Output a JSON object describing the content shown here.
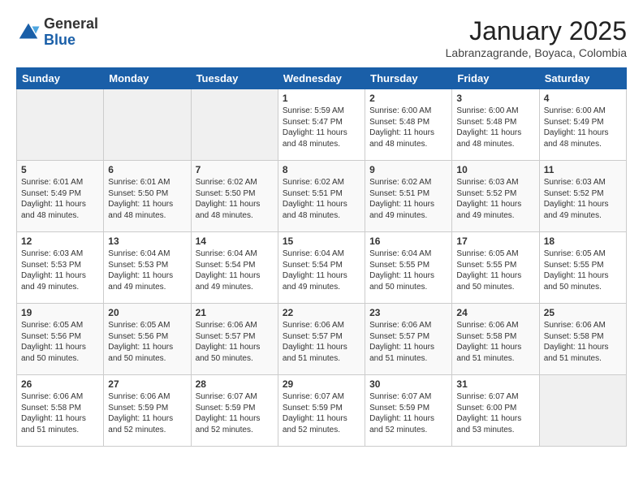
{
  "header": {
    "logo_general": "General",
    "logo_blue": "Blue",
    "month_title": "January 2025",
    "subtitle": "Labranzagrande, Boyaca, Colombia"
  },
  "days_of_week": [
    "Sunday",
    "Monday",
    "Tuesday",
    "Wednesday",
    "Thursday",
    "Friday",
    "Saturday"
  ],
  "weeks": [
    [
      {
        "day": "",
        "content": ""
      },
      {
        "day": "",
        "content": ""
      },
      {
        "day": "",
        "content": ""
      },
      {
        "day": "1",
        "content": "Sunrise: 5:59 AM\nSunset: 5:47 PM\nDaylight: 11 hours and 48 minutes."
      },
      {
        "day": "2",
        "content": "Sunrise: 6:00 AM\nSunset: 5:48 PM\nDaylight: 11 hours and 48 minutes."
      },
      {
        "day": "3",
        "content": "Sunrise: 6:00 AM\nSunset: 5:48 PM\nDaylight: 11 hours and 48 minutes."
      },
      {
        "day": "4",
        "content": "Sunrise: 6:00 AM\nSunset: 5:49 PM\nDaylight: 11 hours and 48 minutes."
      }
    ],
    [
      {
        "day": "5",
        "content": "Sunrise: 6:01 AM\nSunset: 5:49 PM\nDaylight: 11 hours and 48 minutes."
      },
      {
        "day": "6",
        "content": "Sunrise: 6:01 AM\nSunset: 5:50 PM\nDaylight: 11 hours and 48 minutes."
      },
      {
        "day": "7",
        "content": "Sunrise: 6:02 AM\nSunset: 5:50 PM\nDaylight: 11 hours and 48 minutes."
      },
      {
        "day": "8",
        "content": "Sunrise: 6:02 AM\nSunset: 5:51 PM\nDaylight: 11 hours and 48 minutes."
      },
      {
        "day": "9",
        "content": "Sunrise: 6:02 AM\nSunset: 5:51 PM\nDaylight: 11 hours and 49 minutes."
      },
      {
        "day": "10",
        "content": "Sunrise: 6:03 AM\nSunset: 5:52 PM\nDaylight: 11 hours and 49 minutes."
      },
      {
        "day": "11",
        "content": "Sunrise: 6:03 AM\nSunset: 5:52 PM\nDaylight: 11 hours and 49 minutes."
      }
    ],
    [
      {
        "day": "12",
        "content": "Sunrise: 6:03 AM\nSunset: 5:53 PM\nDaylight: 11 hours and 49 minutes."
      },
      {
        "day": "13",
        "content": "Sunrise: 6:04 AM\nSunset: 5:53 PM\nDaylight: 11 hours and 49 minutes."
      },
      {
        "day": "14",
        "content": "Sunrise: 6:04 AM\nSunset: 5:54 PM\nDaylight: 11 hours and 49 minutes."
      },
      {
        "day": "15",
        "content": "Sunrise: 6:04 AM\nSunset: 5:54 PM\nDaylight: 11 hours and 49 minutes."
      },
      {
        "day": "16",
        "content": "Sunrise: 6:04 AM\nSunset: 5:55 PM\nDaylight: 11 hours and 50 minutes."
      },
      {
        "day": "17",
        "content": "Sunrise: 6:05 AM\nSunset: 5:55 PM\nDaylight: 11 hours and 50 minutes."
      },
      {
        "day": "18",
        "content": "Sunrise: 6:05 AM\nSunset: 5:55 PM\nDaylight: 11 hours and 50 minutes."
      }
    ],
    [
      {
        "day": "19",
        "content": "Sunrise: 6:05 AM\nSunset: 5:56 PM\nDaylight: 11 hours and 50 minutes."
      },
      {
        "day": "20",
        "content": "Sunrise: 6:05 AM\nSunset: 5:56 PM\nDaylight: 11 hours and 50 minutes."
      },
      {
        "day": "21",
        "content": "Sunrise: 6:06 AM\nSunset: 5:57 PM\nDaylight: 11 hours and 50 minutes."
      },
      {
        "day": "22",
        "content": "Sunrise: 6:06 AM\nSunset: 5:57 PM\nDaylight: 11 hours and 51 minutes."
      },
      {
        "day": "23",
        "content": "Sunrise: 6:06 AM\nSunset: 5:57 PM\nDaylight: 11 hours and 51 minutes."
      },
      {
        "day": "24",
        "content": "Sunrise: 6:06 AM\nSunset: 5:58 PM\nDaylight: 11 hours and 51 minutes."
      },
      {
        "day": "25",
        "content": "Sunrise: 6:06 AM\nSunset: 5:58 PM\nDaylight: 11 hours and 51 minutes."
      }
    ],
    [
      {
        "day": "26",
        "content": "Sunrise: 6:06 AM\nSunset: 5:58 PM\nDaylight: 11 hours and 51 minutes."
      },
      {
        "day": "27",
        "content": "Sunrise: 6:06 AM\nSunset: 5:59 PM\nDaylight: 11 hours and 52 minutes."
      },
      {
        "day": "28",
        "content": "Sunrise: 6:07 AM\nSunset: 5:59 PM\nDaylight: 11 hours and 52 minutes."
      },
      {
        "day": "29",
        "content": "Sunrise: 6:07 AM\nSunset: 5:59 PM\nDaylight: 11 hours and 52 minutes."
      },
      {
        "day": "30",
        "content": "Sunrise: 6:07 AM\nSunset: 5:59 PM\nDaylight: 11 hours and 52 minutes."
      },
      {
        "day": "31",
        "content": "Sunrise: 6:07 AM\nSunset: 6:00 PM\nDaylight: 11 hours and 53 minutes."
      },
      {
        "day": "",
        "content": ""
      }
    ]
  ]
}
